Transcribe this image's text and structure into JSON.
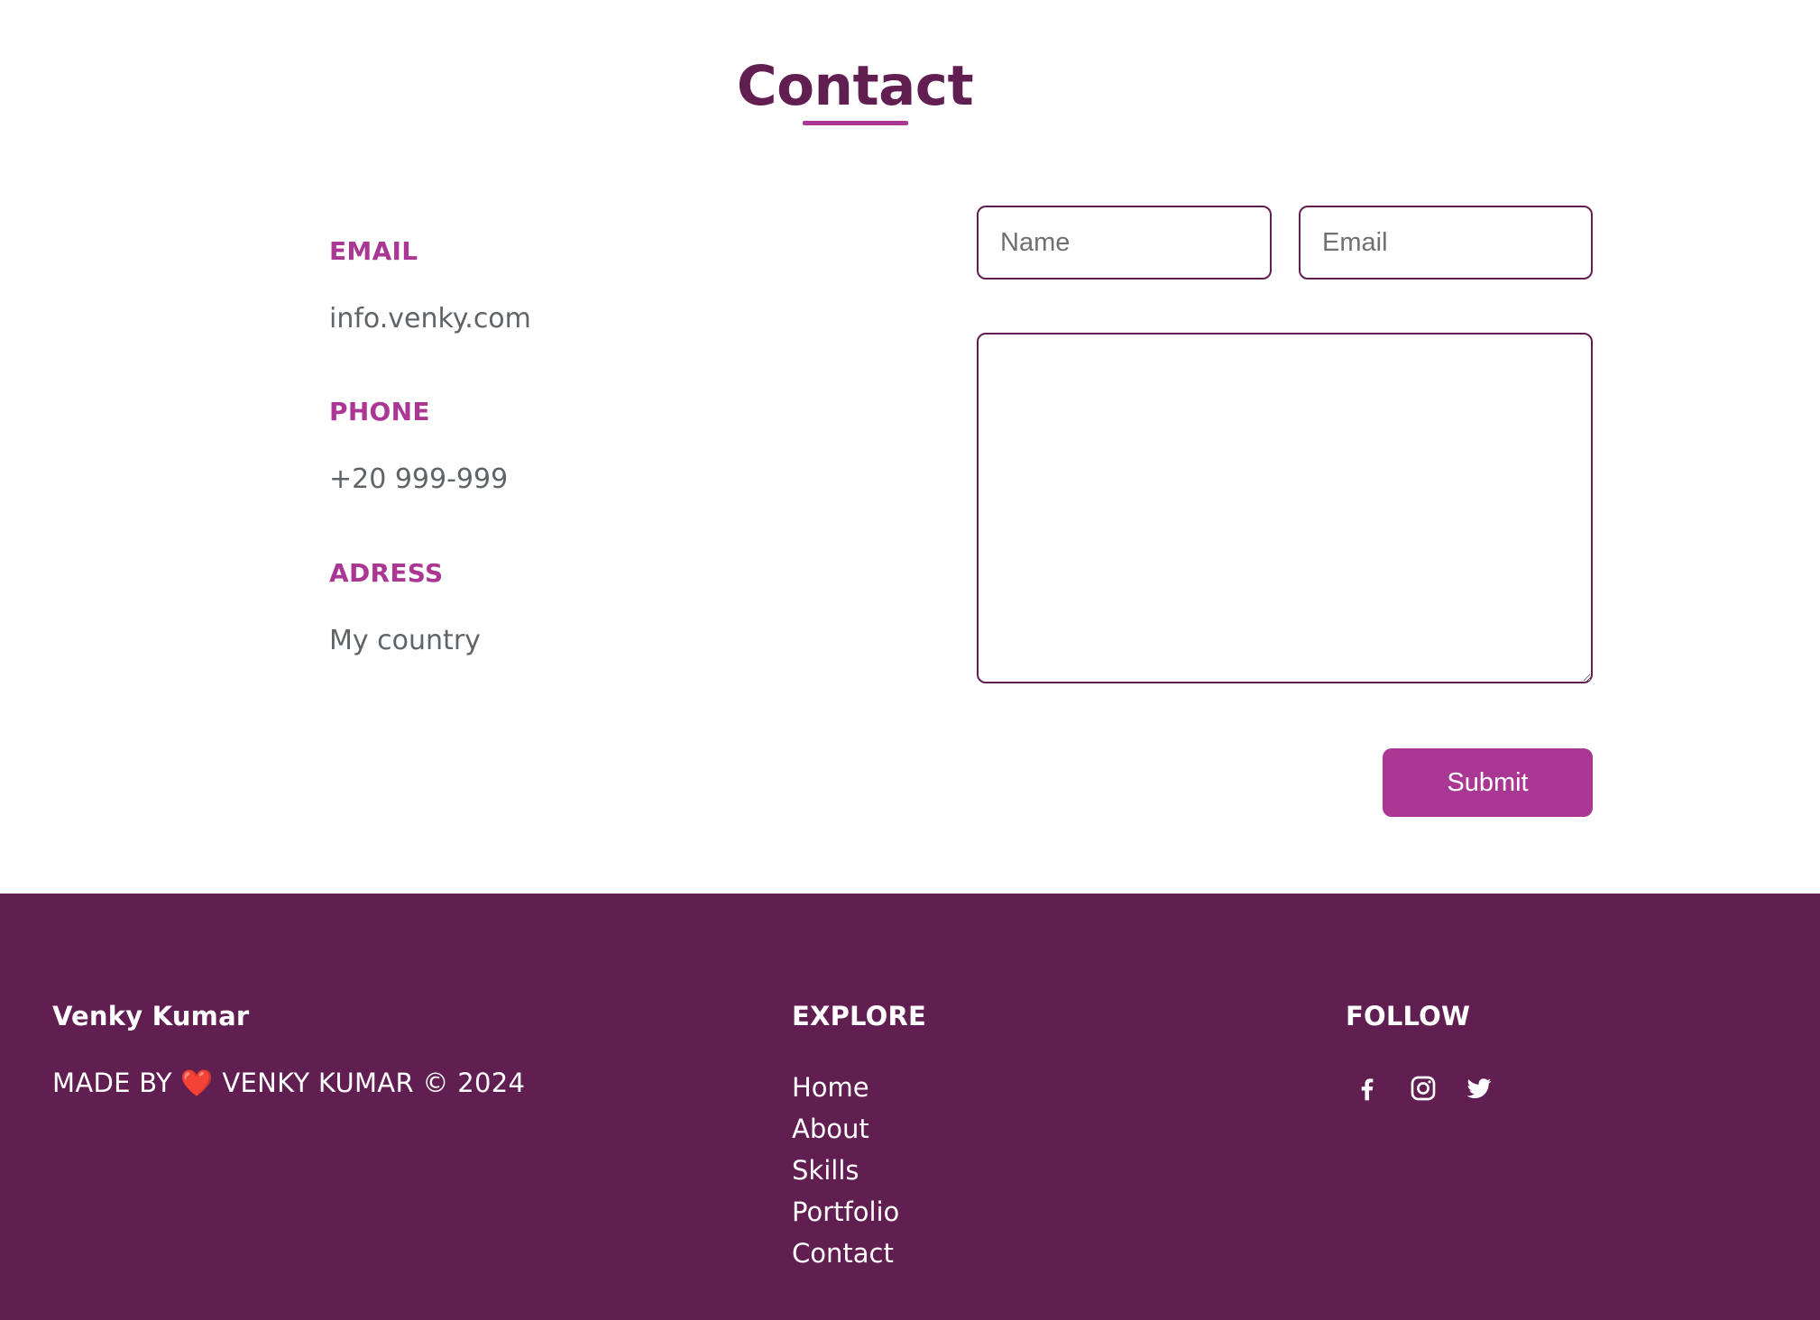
{
  "contact": {
    "title": "Contact",
    "info": {
      "email_label": "EMAIL",
      "email_value": "info.venky.com",
      "phone_label": "PHONE",
      "phone_value": "+20 999-999",
      "address_label": "ADRESS",
      "address_value": "My country"
    },
    "form": {
      "name_placeholder": "Name",
      "email_placeholder": "Email",
      "message_placeholder": "",
      "submit_label": "Submit"
    }
  },
  "footer": {
    "brand": {
      "name": "Venky Kumar",
      "credit_prefix": "MADE BY",
      "heart_emoji": "❤️",
      "credit_suffix": "VENKY KUMAR © 2024"
    },
    "explore": {
      "heading": "EXPLORE",
      "links": [
        "Home",
        "About",
        "Skills",
        "Portfolio",
        "Contact"
      ]
    },
    "follow": {
      "heading": "FOLLOW",
      "icons": [
        "facebook-icon",
        "instagram-icon",
        "twitter-icon"
      ]
    }
  },
  "colors": {
    "primary_dark": "#611e50",
    "accent": "#ab3794",
    "muted_text": "#5f6468",
    "background": "#ffffff"
  }
}
